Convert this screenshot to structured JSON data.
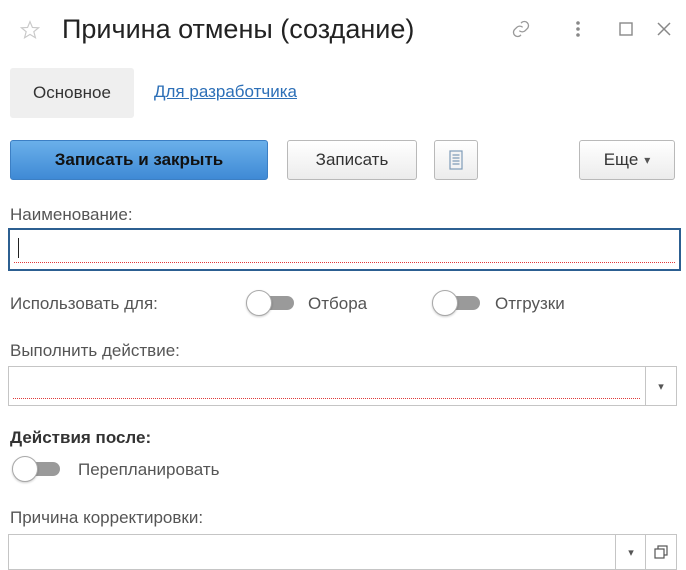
{
  "window": {
    "title": "Причина отмены (создание)"
  },
  "tabs": [
    {
      "label": "Основное"
    },
    {
      "label": "Для разработчика"
    }
  ],
  "toolbar": {
    "save_close_label": "Записать и закрыть",
    "save_label": "Записать",
    "more_label": "Еще",
    "more_arrow": "▾"
  },
  "form": {
    "name_label": "Наименование:",
    "name_value": "",
    "use_for_label": "Использовать для:",
    "toggle_selection_label": "Отбора",
    "toggle_shipment_label": "Отгрузки",
    "action_label": "Выполнить действие:",
    "action_value": "",
    "after_actions_label": "Действия после:",
    "reschedule_label": "Перепланировать",
    "correction_reason_label": "Причина корректировки:",
    "correction_reason_value": ""
  },
  "colors": {
    "primary_button": "#4a93dc",
    "link": "#2c6fb7",
    "focus_border": "#2c5f91",
    "error_underline": "#e03a3a"
  },
  "icons": {
    "favorite": "star-icon",
    "link": "link-icon",
    "menu": "more-vertical-icon",
    "maximize": "maximize-icon",
    "close": "close-icon",
    "report": "document-icon",
    "dropdown": "chevron-down-icon",
    "open": "open-form-icon"
  }
}
